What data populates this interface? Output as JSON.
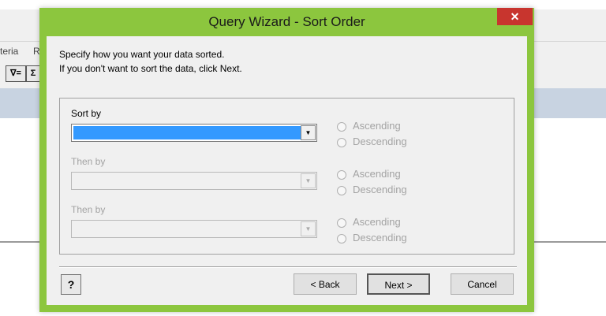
{
  "background": {
    "menu_fragment_1": "teria",
    "menu_fragment_2": "R",
    "filter_button": "∇=",
    "sigma_button": "Σ"
  },
  "dialog": {
    "title": "Query Wizard - Sort Order",
    "close_label": "✕",
    "instruction_1": "Specify how you want your data sorted.",
    "instruction_2": "If you don't want to sort the data, click Next.",
    "sort_rows": [
      {
        "label": "Sort by",
        "value": "",
        "active": true,
        "ascending": "Ascending",
        "descending": "Descending"
      },
      {
        "label": "Then by",
        "value": "",
        "active": false,
        "ascending": "Ascending",
        "descending": "Descending"
      },
      {
        "label": "Then by",
        "value": "",
        "active": false,
        "ascending": "Ascending",
        "descending": "Descending"
      }
    ],
    "buttons": {
      "help": "?",
      "back": "< Back",
      "next": "Next >",
      "cancel": "Cancel"
    }
  },
  "colors": {
    "window_frame": "#8cc63e",
    "close_button": "#c8352e",
    "selection": "#3399ff"
  }
}
